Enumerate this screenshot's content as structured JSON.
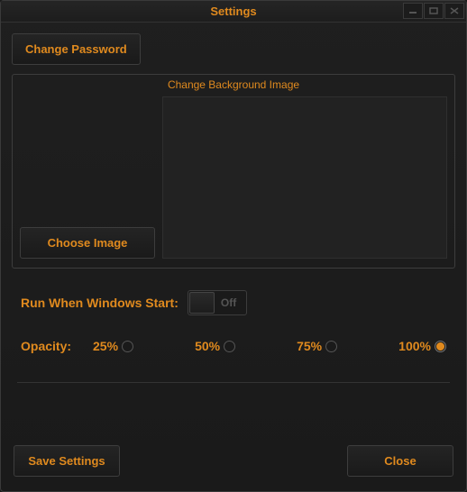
{
  "window": {
    "title": "Settings"
  },
  "buttons": {
    "change_password": "Change Password",
    "choose_image": "Choose Image",
    "save_settings": "Save Settings",
    "close": "Close"
  },
  "bg_section": {
    "title": "Change Background Image"
  },
  "run_start": {
    "label": "Run When Windows Start:",
    "state_label": "Off",
    "value": false
  },
  "opacity": {
    "label": "Opacity:",
    "options": [
      {
        "label": "25%",
        "value": 25,
        "checked": false
      },
      {
        "label": "50%",
        "value": 50,
        "checked": false
      },
      {
        "label": "75%",
        "value": 75,
        "checked": false
      },
      {
        "label": "100%",
        "value": 100,
        "checked": true
      }
    ]
  }
}
